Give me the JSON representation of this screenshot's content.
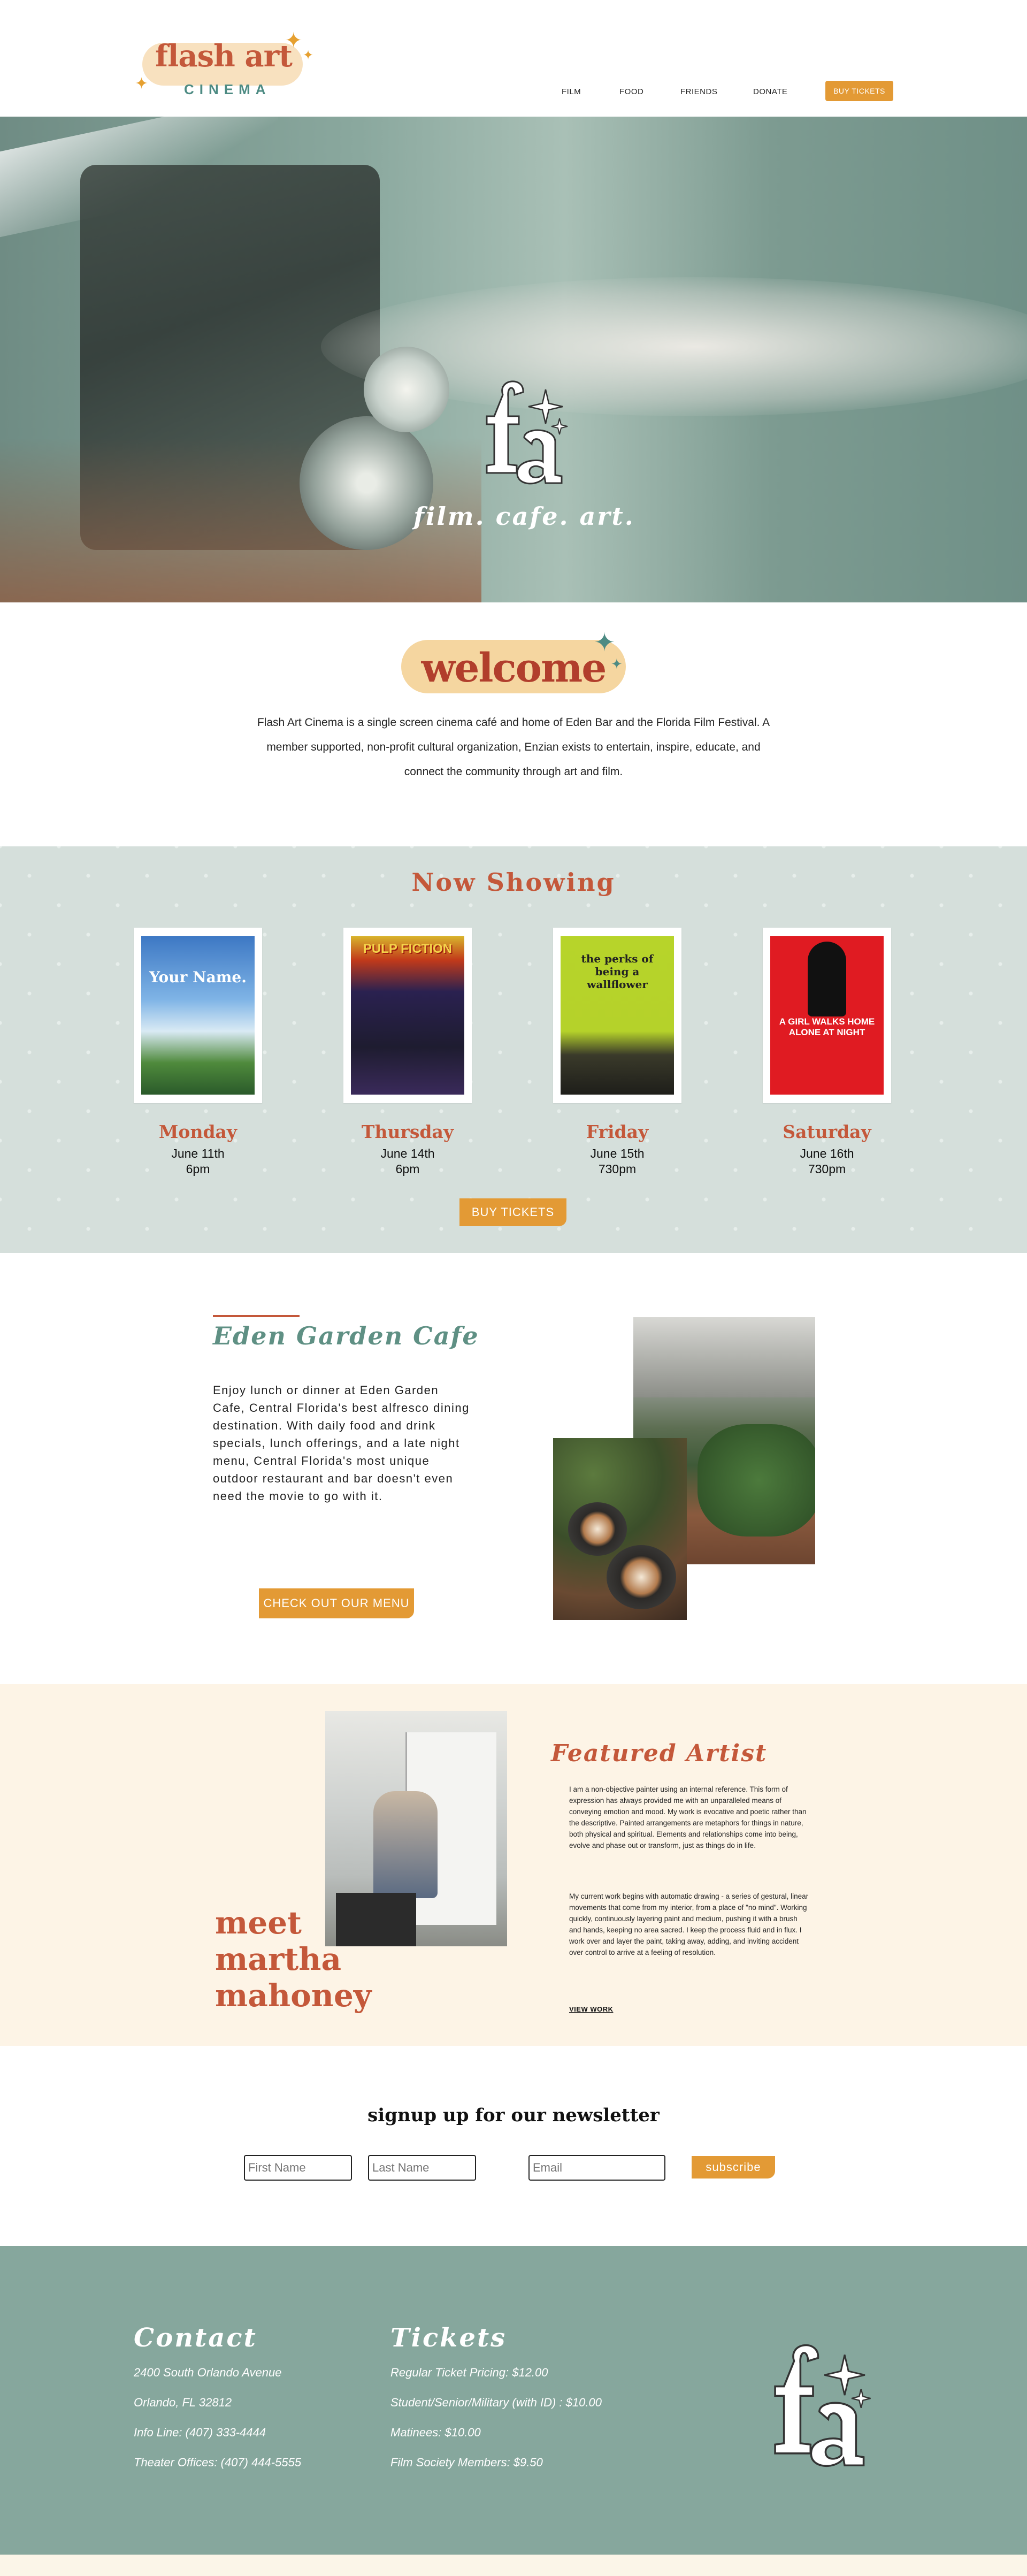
{
  "header": {
    "logo_main": "flash art",
    "logo_sub": "CINEMA",
    "nav": [
      "FILM",
      "FOOD",
      "FRIENDS",
      "DONATE"
    ],
    "buy_tickets": "BUY TICKETS"
  },
  "hero": {
    "tagline": "film. cafe. art."
  },
  "welcome": {
    "title": "welcome",
    "text": "Flash Art Cinema is a single screen cinema café and home of Eden Bar and the Florida Film Festival. A member supported, non-profit cultural organization, Enzian exists to entertain, inspire, educate, and connect the community through art and film."
  },
  "now_showing": {
    "title": "Now Showing",
    "movies": [
      {
        "poster_title": "Your Name.",
        "day": "Monday",
        "date": "June 11th",
        "time": "6pm"
      },
      {
        "poster_title": "PULP FICTION",
        "day": "Thursday",
        "date": "June 14th",
        "time": "6pm"
      },
      {
        "poster_title": "the perks of being a wallflower",
        "day": "Friday",
        "date": "June 15th",
        "time": "730pm"
      },
      {
        "poster_title": "A GIRL WALKS HOME ALONE AT NIGHT",
        "day": "Saturday",
        "date": "June 16th",
        "time": "730pm"
      }
    ],
    "buy_button": "BUY TICKETS"
  },
  "cafe": {
    "title": "Eden Garden Cafe",
    "text": "Enjoy lunch or dinner at Eden Garden Cafe, Central Florida's best alfresco dining destination. With daily food and drink specials, lunch offerings, and a late night menu, Central Florida's most unique outdoor restaurant and bar doesn't even need the movie to go with it.",
    "menu_button": "CHECK OUT OUR MENU"
  },
  "artist": {
    "meet": [
      "meet",
      "martha",
      "mahoney"
    ],
    "title": "Featured Artist",
    "paragraph1": "I am a non-objective painter using an internal reference. This form of expression has always provided me with an unparalleled means of conveying emotion and mood. My work is evocative and poetic rather than the descriptive. Painted arrangements are metaphors for things in nature, both physical and spiritual. Elements and relationships come into being, evolve and phase out or transform, just as things do in life.",
    "paragraph2": "My current work begins with automatic drawing - a series of gestural, linear movements that come from my interior, from a place of \"no mind\". Working quickly, continuously layering paint and medium, pushing it with a brush and hands, keeping no area sacred. I keep the process fluid and in flux. I work over and layer the paint, taking away, adding, and inviting accident over control to arrive at a feeling of resolution.",
    "view_work": "VIEW WORK"
  },
  "newsletter": {
    "title": "signup up for our newsletter",
    "first_placeholder": "First Name",
    "last_placeholder": "Last Name",
    "email_placeholder": "Email",
    "submit": "subscribe"
  },
  "footer": {
    "contact_title": "Contact",
    "contact_lines": [
      "2400 South Orlando Avenue",
      "Orlando, FL 32812",
      "Info Line: (407) 333-4444",
      "Theater Offices: (407) 444-5555"
    ],
    "tickets_title": "Tickets",
    "ticket_lines": [
      "Regular Ticket Pricing: $12.00",
      "Student/Senior/Military (with ID) : $10.00",
      "Matinees: $10.00",
      "Film Society Members: $9.50"
    ]
  },
  "colors": {
    "accent_orange": "#e39a35",
    "brand_red": "#c4583a",
    "teal": "#5f9084",
    "footer_green": "#86a79d"
  }
}
